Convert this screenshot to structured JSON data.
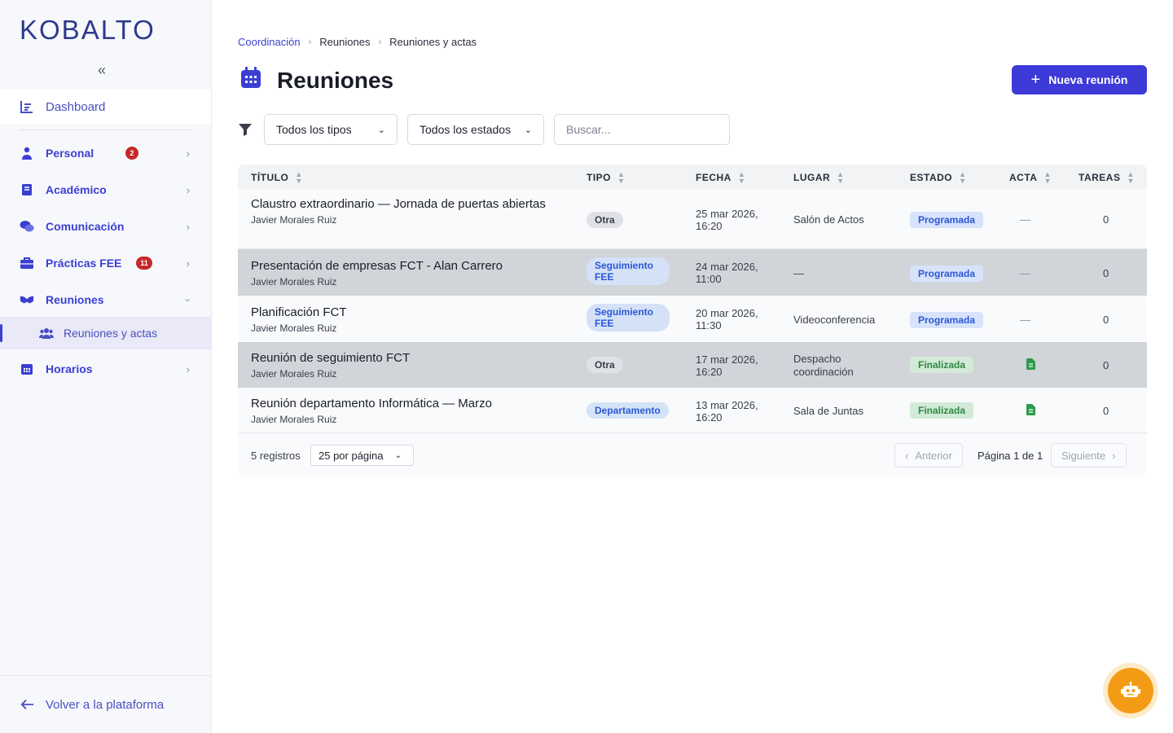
{
  "brand": {
    "logo": "KOBALTO",
    "collapse_icon": "chevrons-left-icon"
  },
  "sidebar": {
    "dashboard": "Dashboard",
    "items": [
      {
        "label": "Personal",
        "badge": "2",
        "icon": "person-icon"
      },
      {
        "label": "Académico",
        "badge": "",
        "icon": "book-icon"
      },
      {
        "label": "Comunicación",
        "badge": "",
        "icon": "chat-icon"
      },
      {
        "label": "Prácticas FEE",
        "badge": "11",
        "icon": "briefcase-icon"
      },
      {
        "label": "Reuniones",
        "badge": "",
        "icon": "handshake-icon"
      },
      {
        "label": "Horarios",
        "badge": "",
        "icon": "calendar-icon"
      }
    ],
    "sub_item": "Reuniones y actas",
    "back": "Volver a la plataforma"
  },
  "breadcrumb": [
    "Coordinación",
    "Reuniones",
    "Reuniones y actas"
  ],
  "page": {
    "title": "Reuniones",
    "new_button": "Nueva reunión"
  },
  "filters": {
    "type": "Todos los tipos",
    "status": "Todos los estados",
    "search_placeholder": "Buscar..."
  },
  "table": {
    "headers": [
      "TÍTULO",
      "TIPO",
      "FECHA",
      "LUGAR",
      "ESTADO",
      "ACTA",
      "TAREAS"
    ],
    "rows": [
      {
        "title": "Claustro extraordinario — Jornada de puertas abiertas",
        "author": "Javier Morales Ruiz",
        "type": "Otra",
        "date": "25 mar 2026,",
        "time": "16:20",
        "place": "Salón de Actos",
        "status": "Programada",
        "acta": "—",
        "tasks": "0"
      },
      {
        "title": "Presentación de empresas FCT - Alan Carrero",
        "author": "Javier Morales Ruiz",
        "type": "Seguimiento FEE",
        "date": "24 mar 2026,",
        "time": "11:00",
        "place": "—",
        "status": "Programada",
        "acta": "—",
        "tasks": "0"
      },
      {
        "title": "Planificación FCT",
        "author": "Javier Morales Ruiz",
        "type": "Seguimiento FEE",
        "date": "20 mar 2026,",
        "time": "11:30",
        "place": "Videoconferencia",
        "status": "Programada",
        "acta": "—",
        "tasks": "0"
      },
      {
        "title": "Reunión de seguimiento FCT",
        "author": "Javier Morales Ruiz",
        "type": "Otra",
        "date": "17 mar 2026,",
        "time": "16:20",
        "place": "Despacho coordinación",
        "status": "Finalizada",
        "acta": "document-icon",
        "tasks": "0"
      },
      {
        "title": "Reunión departamento Informática — Marzo",
        "author": "Javier Morales Ruiz",
        "type": "Departamento",
        "date": "13 mar 2026,",
        "time": "16:20",
        "place": "Sala de Juntas",
        "status": "Finalizada",
        "acta": "document-icon",
        "tasks": "0"
      }
    ]
  },
  "pagination": {
    "count": "5 registros",
    "per_page": "25 por página",
    "prev": "Anterior",
    "info": "Página 1 de 1",
    "next": "Siguiente"
  },
  "colors": {
    "accent": "#3d3ad8",
    "bot": "#f49b15",
    "finalizada": "#2f8a43",
    "programada": "#2b57d6"
  }
}
